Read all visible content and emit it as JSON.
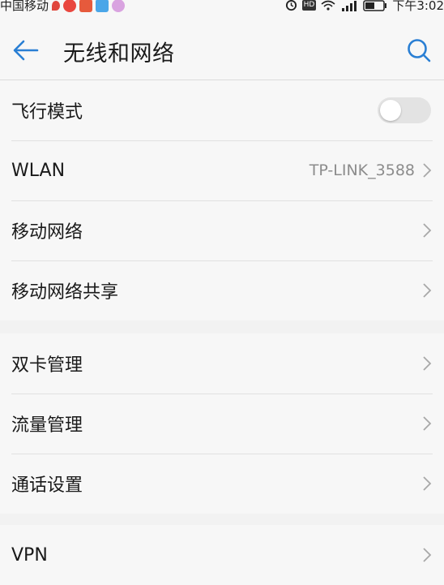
{
  "status_bar": {
    "carrier": "中国移动",
    "time": "下午3:02",
    "hd_badge": "HD",
    "notification_icons": [
      {
        "name": "location-pin-icon",
        "color": "#e0463c"
      },
      {
        "name": "weibo-app-icon",
        "color": "#e9473f"
      },
      {
        "name": "news-app-icon",
        "color": "#e65a3c"
      },
      {
        "name": "qq-app-icon",
        "color": "#4aa6e8"
      },
      {
        "name": "candy-app-icon",
        "color": "#d9a3e0"
      }
    ]
  },
  "header": {
    "title": "无线和网络",
    "back_icon": "back-arrow-icon",
    "search_icon": "search-icon",
    "accent_color": "#2a7fd4"
  },
  "groups": [
    {
      "items": [
        {
          "label": "飞行模式",
          "type": "toggle",
          "toggle_on": false
        },
        {
          "label": "WLAN",
          "type": "link",
          "value": "TP-LINK_3588"
        },
        {
          "label": "移动网络",
          "type": "link"
        },
        {
          "label": "移动网络共享",
          "type": "link"
        }
      ]
    },
    {
      "items": [
        {
          "label": "双卡管理",
          "type": "link"
        },
        {
          "label": "流量管理",
          "type": "link"
        },
        {
          "label": "通话设置",
          "type": "link"
        }
      ]
    },
    {
      "items": [
        {
          "label": "VPN",
          "type": "link"
        }
      ]
    }
  ]
}
